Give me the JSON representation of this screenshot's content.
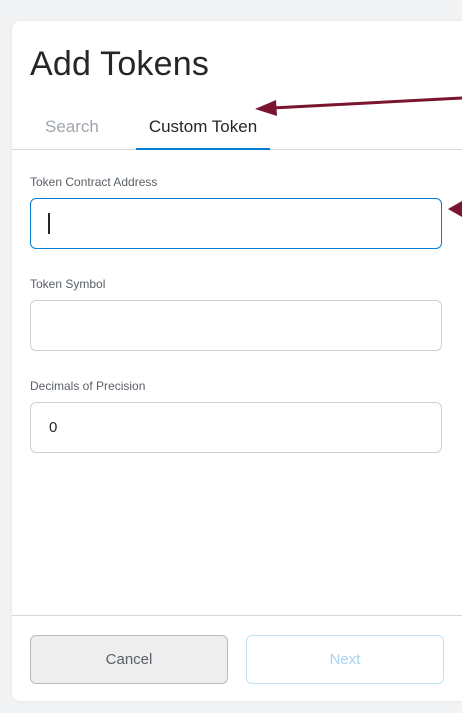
{
  "dialog": {
    "title": "Add Tokens"
  },
  "tabs": [
    {
      "label": "Search",
      "active": false
    },
    {
      "label": "Custom Token",
      "active": true
    }
  ],
  "form": {
    "contract_address": {
      "label": "Token Contract Address",
      "value": ""
    },
    "symbol": {
      "label": "Token Symbol",
      "value": ""
    },
    "decimals": {
      "label": "Decimals of Precision",
      "value": "0"
    }
  },
  "footer": {
    "cancel_label": "Cancel",
    "next_label": "Next"
  },
  "colors": {
    "accent": "#037dd6",
    "annotation_arrow": "#7a1530"
  }
}
